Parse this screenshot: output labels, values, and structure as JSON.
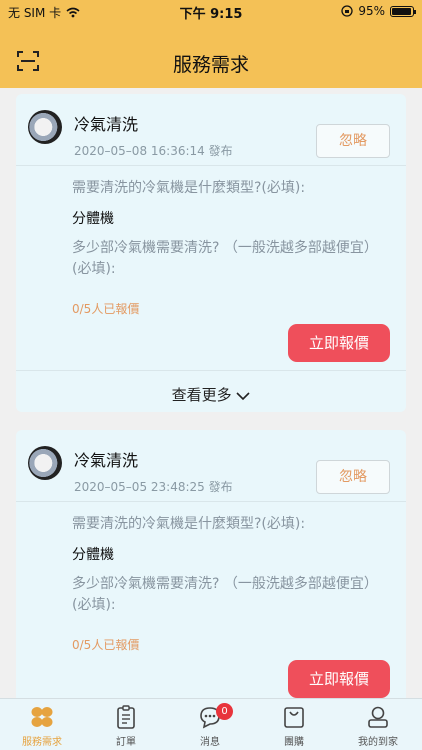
{
  "status_bar": {
    "carrier": "无 SIM 卡",
    "time": "下午 9:15",
    "battery": "95%",
    "battery_level": 0.95
  },
  "header": {
    "title": "服務需求",
    "scan_icon": "scan-icon"
  },
  "cards": [
    {
      "service": "冷氣清洗",
      "posted": "2020–05–08 16:36:14 發布",
      "ignore_label": "忽略",
      "q1": "需要清洗的冷氣機是什麼類型?(必填):",
      "a1": "分體機",
      "q2": "多少部冷氣機需要清洗? （一般洗越多部越便宜）(必填):",
      "quote_count": "0/5人已報價",
      "quote_button": "立即報價",
      "more_label": "查看更多"
    },
    {
      "service": "冷氣清洗",
      "posted": "2020–05–05 23:48:25 發布",
      "ignore_label": "忽略",
      "q1": "需要清洗的冷氣機是什麼類型?(必填):",
      "a1": "分體機",
      "q2": "多少部冷氣機需要清洗? （一般洗越多部越便宜）(必填):",
      "quote_count": "0/5人已報價",
      "quote_button": "立即報價"
    }
  ],
  "tabbar": {
    "items": [
      {
        "label": "服務需求",
        "icon": "grid-icon",
        "active": true
      },
      {
        "label": "訂單",
        "icon": "clipboard-icon"
      },
      {
        "label": "消息",
        "icon": "chat-icon",
        "badge": "0"
      },
      {
        "label": "團購",
        "icon": "bag-icon"
      },
      {
        "label": "我的到家",
        "icon": "user-icon"
      }
    ]
  },
  "colors": {
    "header": "#f4c156",
    "card": "#e9f7fb",
    "accent_red": "#ef4f5b",
    "accent_orange": "#e39a62",
    "active_tab": "#e6a33f"
  }
}
